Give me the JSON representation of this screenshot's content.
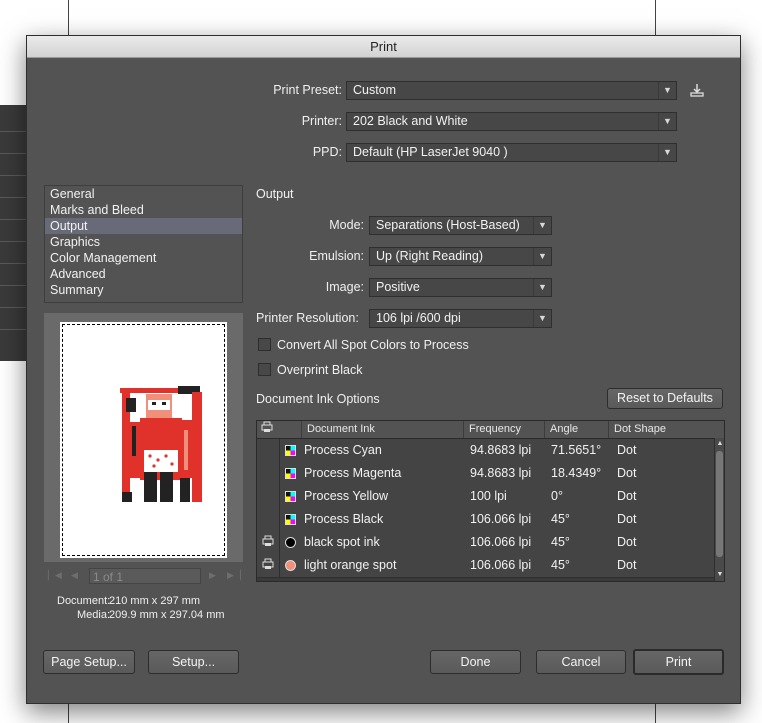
{
  "window": {
    "title": "Print"
  },
  "preset": {
    "label": "Print Preset:",
    "value": "Custom"
  },
  "printer": {
    "label": "Printer:",
    "value": "202 Black and White"
  },
  "ppd": {
    "label": "PPD:",
    "value": "Default (HP LaserJet 9040 )"
  },
  "categories": [
    {
      "label": "General"
    },
    {
      "label": "Marks and Bleed"
    },
    {
      "label": "Output",
      "selected": true
    },
    {
      "label": "Graphics"
    },
    {
      "label": "Color Management"
    },
    {
      "label": "Advanced"
    },
    {
      "label": "Summary"
    }
  ],
  "preview": {
    "page_indicator": "1 of 1",
    "document_label": "Document:",
    "document_value": "210 mm x 297 mm",
    "media_label": "Media:",
    "media_value": "209.9 mm x 297.04 mm"
  },
  "output": {
    "section_title": "Output",
    "mode": {
      "label": "Mode:",
      "value": "Separations (Host-Based)"
    },
    "emulsion": {
      "label": "Emulsion:",
      "value": "Up (Right Reading)"
    },
    "image": {
      "label": "Image:",
      "value": "Positive"
    },
    "resolution": {
      "label": "Printer Resolution:",
      "value": "106 lpi /600 dpi"
    },
    "convert_spot": {
      "label": "Convert All Spot Colors to Process",
      "checked": false
    },
    "overprint_black": {
      "label": "Overprint Black",
      "checked": false
    }
  },
  "ink_options": {
    "title": "Document Ink Options",
    "reset_label": "Reset to Defaults",
    "columns": [
      "Document Ink",
      "Frequency",
      "Angle",
      "Dot Shape"
    ],
    "rows": [
      {
        "ink": "Process Cyan",
        "frequency": "94.8683 lpi",
        "angle": "71.5651°",
        "shape": "Dot",
        "swatch": "process",
        "print": false
      },
      {
        "ink": "Process Magenta",
        "frequency": "94.8683 lpi",
        "angle": "18.4349°",
        "shape": "Dot",
        "swatch": "process",
        "print": false
      },
      {
        "ink": "Process Yellow",
        "frequency": "100 lpi",
        "angle": "0°",
        "shape": "Dot",
        "swatch": "process",
        "print": false
      },
      {
        "ink": "Process Black",
        "frequency": "106.066 lpi",
        "angle": "45°",
        "shape": "Dot",
        "swatch": "process",
        "print": false
      },
      {
        "ink": "black spot ink",
        "frequency": "106.066 lpi",
        "angle": "45°",
        "shape": "Dot",
        "swatch": "black",
        "print": true
      },
      {
        "ink": "light orange spot",
        "frequency": "106.066 lpi",
        "angle": "45°",
        "shape": "Dot",
        "swatch": "orange",
        "print": true
      }
    ]
  },
  "buttons": {
    "page_setup": "Page Setup...",
    "setup": "Setup...",
    "done": "Done",
    "cancel": "Cancel",
    "print": "Print"
  },
  "colors": {
    "dialog_bg": "#535353",
    "selection": "#686a78",
    "accent_red": "#e0322a",
    "spot_orange": "#f0907a"
  },
  "icons": {
    "save_preset": "save-preset-icon",
    "printer_column": "printer-icon",
    "swatch_process": "process-swatch-icon"
  }
}
